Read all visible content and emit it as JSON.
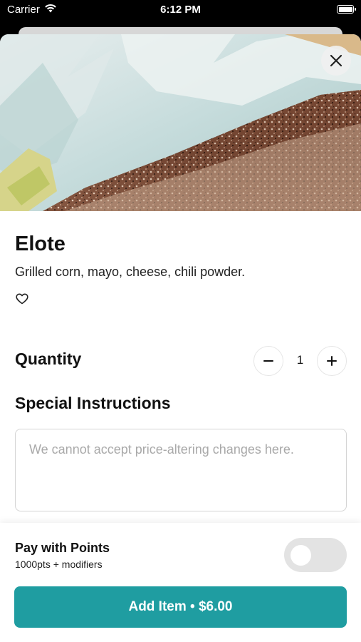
{
  "status_bar": {
    "carrier": "Carrier",
    "time": "6:12 PM",
    "battery_level": 1.0
  },
  "item": {
    "image_alt": "",
    "title": "Elote",
    "description": "Grilled corn, mayo, cheese, chili powder.",
    "favorite": false
  },
  "quantity": {
    "label": "Quantity",
    "value": "1"
  },
  "instructions": {
    "label": "Special Instructions",
    "placeholder": "We cannot accept price-altering changes here.",
    "value": ""
  },
  "points": {
    "title": "Pay with Points",
    "subtitle": "1000pts + modifiers",
    "enabled": false
  },
  "add_button": {
    "label": "Add Item • $6.00"
  },
  "colors": {
    "accent": "#1f9da1",
    "toggle_off": "#e3e3e3"
  },
  "icons": {
    "close": "close-icon",
    "favorite": "heart-outline-icon",
    "decrement": "minus-icon",
    "increment": "plus-icon",
    "wifi": "wifi-icon",
    "battery": "battery-icon"
  }
}
